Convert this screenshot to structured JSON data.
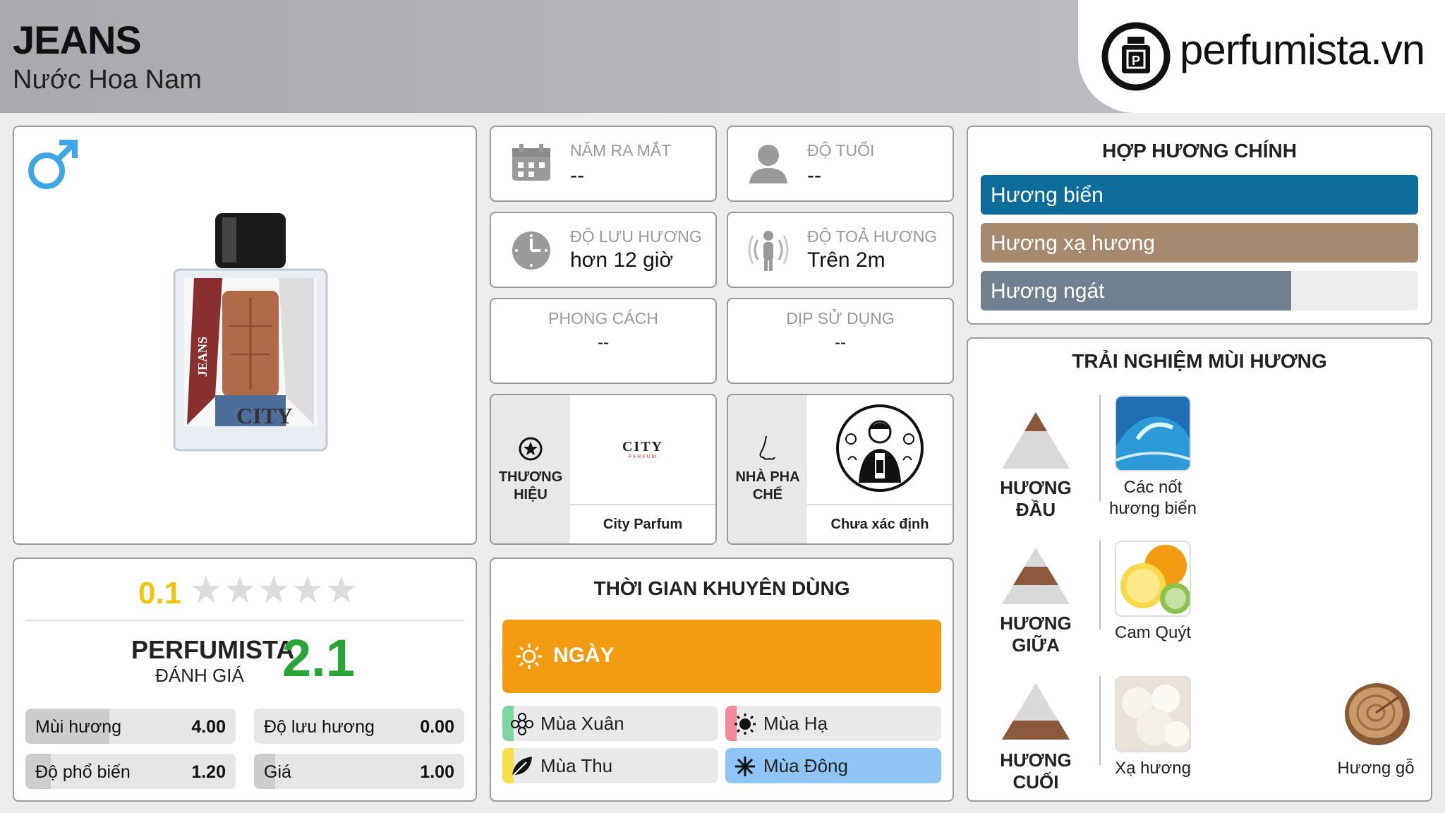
{
  "header": {
    "title": "JEANS",
    "subtitle": "Nước Hoa Nam",
    "brand_logo_text": "perfumista.vn"
  },
  "product": {
    "gender_icon": "male-icon",
    "bottle_label": "JEANS",
    "bottle_brand": "CITY"
  },
  "info": {
    "launch_year": {
      "label": "NĂM RA MẮT",
      "value": "--"
    },
    "age": {
      "label": "ĐỘ TUỔI",
      "value": "--"
    },
    "longevity": {
      "label": "ĐỘ LƯU HƯƠNG",
      "value": "hơn 12 giờ"
    },
    "sillage": {
      "label": "ĐỘ TOẢ HƯƠNG",
      "value": "Trên 2m"
    },
    "style": {
      "label": "PHONG CÁCH",
      "value": "--"
    },
    "occasion": {
      "label": "DỊP SỬ DỤNG",
      "value": "--"
    },
    "brand": {
      "label": "THƯƠNG HIỆU",
      "logo_text": "CITY",
      "logo_sub": "PARFUM",
      "name": "City Parfum"
    },
    "perfumer": {
      "label": "NHÀ PHA CHẾ",
      "name": "Chưa xác định"
    }
  },
  "accords": {
    "title": "HỢP HƯƠNG CHÍNH",
    "items": [
      {
        "label": "Hương biển",
        "color": "#0e6c9a",
        "level": 1.0
      },
      {
        "label": "Hương xạ hương",
        "color": "#a68a70",
        "level": 1.0
      },
      {
        "label": "Hương ngát",
        "color": "#708090",
        "level": 0.71
      }
    ]
  },
  "rating": {
    "user_score": "0.1",
    "stars": 5,
    "perfumista_label": "PERFUMISTA",
    "perfumista_sub": "ĐÁNH GIÁ",
    "perfumista_score": "2.1",
    "metrics": [
      {
        "label": "Mùi hương",
        "value": "4.00",
        "level": 0.4
      },
      {
        "label": "Độ lưu hương",
        "value": "0.00",
        "level": 0.0
      },
      {
        "label": "Độ phổ biến",
        "value": "1.20",
        "level": 0.12
      },
      {
        "label": "Giá",
        "value": "1.00",
        "level": 0.1
      }
    ]
  },
  "time": {
    "title": "THỜI GIAN KHUYÊN DÙNG",
    "day_label": "NGÀY",
    "day_color": "#f39c12",
    "seasons": [
      {
        "label": "Mùa Xuân",
        "icon": "flower-icon",
        "color": "#7ed6a0",
        "active": false
      },
      {
        "label": "Mùa Hạ",
        "icon": "sun-icon",
        "color": "#f08a9a",
        "active": false
      },
      {
        "label": "Mùa Thu",
        "icon": "leaf-icon",
        "color": "#f5e04a",
        "active": false
      },
      {
        "label": "Mùa Đông",
        "icon": "snowflake-icon",
        "color": "#8ec5f5",
        "active": true
      }
    ]
  },
  "notes": {
    "title": "TRẢI NGHIỆM MÙI HƯƠNG",
    "top": {
      "label": "HƯƠNG ĐẦU",
      "items": [
        "Các nốt hương biển"
      ]
    },
    "middle": {
      "label": "HƯƠNG GIỮA",
      "items": [
        "Cam Quýt"
      ]
    },
    "base": {
      "label": "HƯƠNG CUỐI",
      "items": [
        "Xạ hương",
        "Hương gỗ"
      ]
    }
  }
}
